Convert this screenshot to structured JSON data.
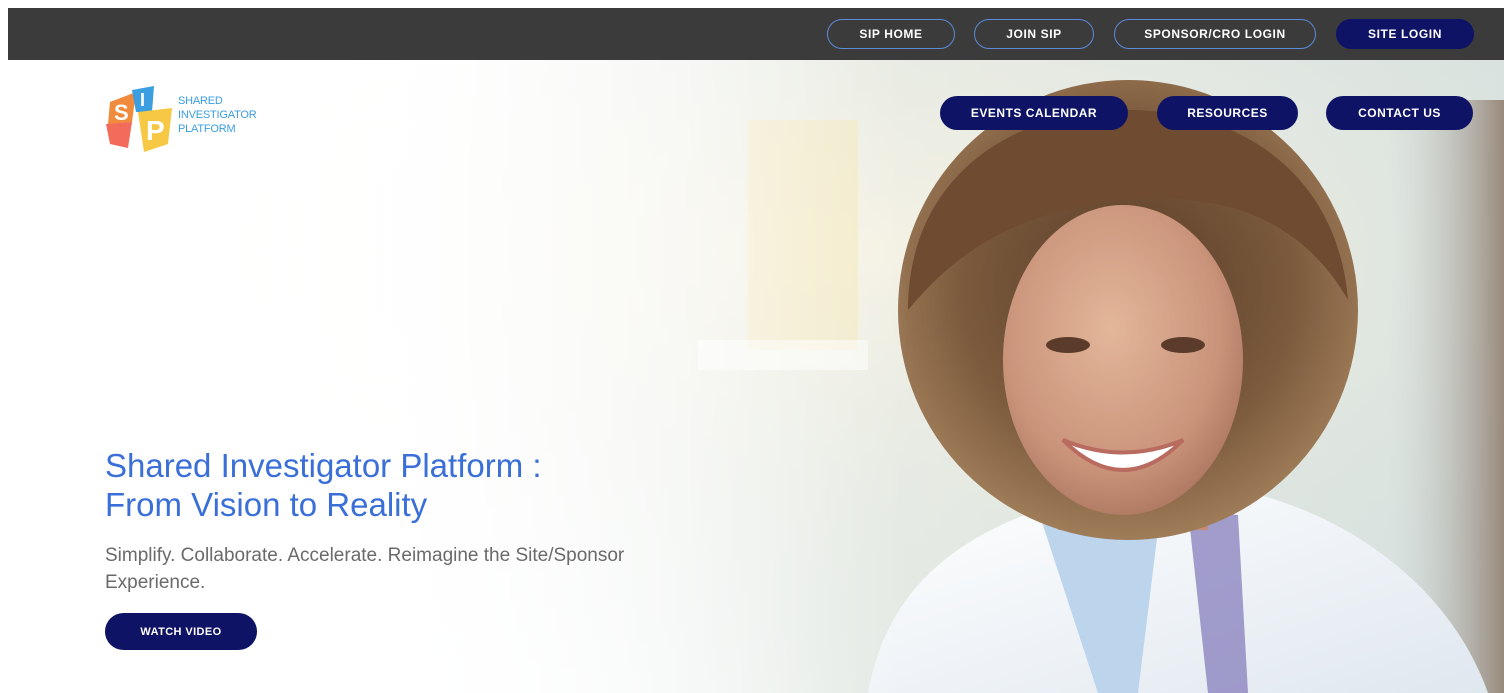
{
  "topbar": {
    "items": [
      {
        "label": "SIP HOME"
      },
      {
        "label": "JOIN SIP"
      },
      {
        "label": "SPONSOR/CRO LOGIN"
      },
      {
        "label": "SITE LOGIN"
      }
    ]
  },
  "logo": {
    "lines": [
      "SHARED",
      "INVESTIGATOR",
      "PLATFORM"
    ],
    "mark_letters": [
      "S",
      "I",
      "P"
    ]
  },
  "nav": {
    "items": [
      {
        "label": "EVENTS CALENDAR"
      },
      {
        "label": "RESOURCES"
      },
      {
        "label": "CONTACT US"
      }
    ]
  },
  "hero": {
    "headline_line1": "Shared Investigator Platform :",
    "headline_line2": "From Vision to Reality",
    "tagline": "Simplify. Collaborate. Accelerate. Reimagine the Site/Sponsor Experience.",
    "cta_label": "WATCH VIDEO",
    "photo_subject": "smiling-clinician-photo"
  },
  "colors": {
    "topbar_bg": "#3b3b3b",
    "navy": "#0f1366",
    "outline_blue": "#5b8bd9",
    "headline_blue": "#3a6fd8",
    "logo_blue": "#3a9ee0",
    "logo_orange": "#f08a3c",
    "logo_yellow": "#f7c843"
  }
}
